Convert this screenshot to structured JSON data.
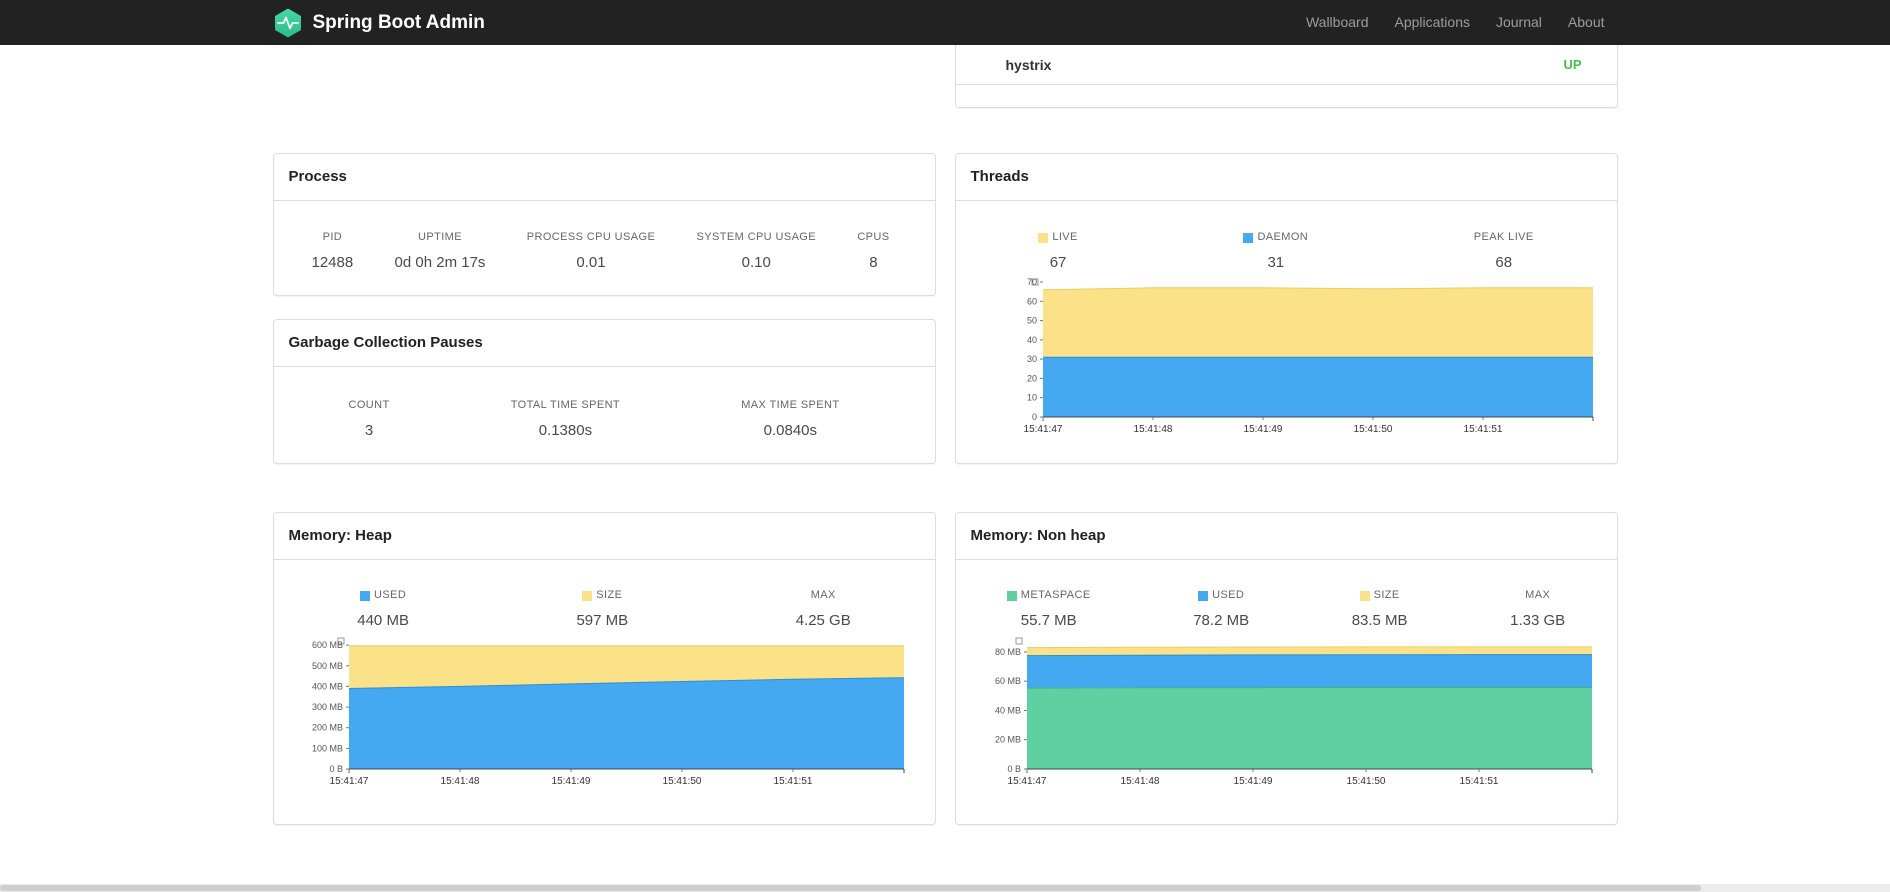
{
  "colors": {
    "accent_teal": "#36cf9b",
    "navbar_bg": "#222222",
    "status_up_green": "#42c047",
    "series_yellow": "#fbe187",
    "series_blue": "#45a9f1",
    "series_green": "#5ed0a2"
  },
  "navbar": {
    "brand": "Spring Boot Admin",
    "items": [
      {
        "label": "Wallboard"
      },
      {
        "label": "Applications"
      },
      {
        "label": "Journal"
      },
      {
        "label": "About"
      }
    ]
  },
  "applications_panel": {
    "rows": [
      {
        "name": "hystrix",
        "status": "UP"
      }
    ]
  },
  "process_panel": {
    "title": "Process",
    "metrics": [
      {
        "label": "PID",
        "value": "12488"
      },
      {
        "label": "UPTIME",
        "value": "0d 0h 2m 17s"
      },
      {
        "label": "PROCESS CPU USAGE",
        "value": "0.01"
      },
      {
        "label": "SYSTEM CPU USAGE",
        "value": "0.10"
      },
      {
        "label": "CPUS",
        "value": "8"
      }
    ]
  },
  "gc_panel": {
    "title": "Garbage Collection Pauses",
    "metrics": [
      {
        "label": "COUNT",
        "value": "3"
      },
      {
        "label": "TOTAL TIME SPENT",
        "value": "0.1380s"
      },
      {
        "label": "MAX TIME SPENT",
        "value": "0.0840s"
      }
    ]
  },
  "threads_panel": {
    "title": "Threads",
    "legend": [
      {
        "label": "LIVE",
        "value": "67",
        "swatch": "yellow"
      },
      {
        "label": "DAEMON",
        "value": "31",
        "swatch": "blue"
      },
      {
        "label": "PEAK LIVE",
        "value": "68",
        "swatch": null
      }
    ],
    "chart_data": {
      "type": "area",
      "x_labels": [
        "15:41:47",
        "15:41:48",
        "15:41:49",
        "15:41:50",
        "15:41:51"
      ],
      "y_ticks": [
        [
          0,
          "0"
        ],
        [
          10,
          "10"
        ],
        [
          20,
          "20"
        ],
        [
          30,
          "30"
        ],
        [
          40,
          "40"
        ],
        [
          50,
          "50"
        ],
        [
          60,
          "60"
        ],
        [
          70,
          "70"
        ]
      ],
      "ymax": 70,
      "series": [
        {
          "name": "LIVE",
          "color": "#fbe187",
          "stroke": "#eccd62",
          "values": [
            66,
            67,
            67,
            66.5,
            67,
            67
          ]
        },
        {
          "name": "DAEMON",
          "color": "#45a9f1",
          "stroke": "#2b8fd9",
          "values": [
            31,
            31,
            31,
            31,
            31,
            31
          ]
        }
      ]
    }
  },
  "memory_heap_panel": {
    "title": "Memory: Heap",
    "legend": [
      {
        "label": "USED",
        "value": "440 MB",
        "swatch": "blue"
      },
      {
        "label": "SIZE",
        "value": "597 MB",
        "swatch": "yellow"
      },
      {
        "label": "MAX",
        "value": "4.25 GB",
        "swatch": null
      }
    ],
    "chart_data": {
      "type": "area",
      "x_labels": [
        "15:41:47",
        "15:41:48",
        "15:41:49",
        "15:41:50",
        "15:41:51"
      ],
      "y_ticks": [
        [
          0,
          "0 B"
        ],
        [
          100,
          "100 MB"
        ],
        [
          200,
          "200 MB"
        ],
        [
          300,
          "300 MB"
        ],
        [
          400,
          "400 MB"
        ],
        [
          500,
          "500 MB"
        ],
        [
          600,
          "600 MB"
        ]
      ],
      "ymax": 620,
      "series": [
        {
          "name": "SIZE",
          "color": "#fbe187",
          "stroke": "#eccd62",
          "values": [
            597,
            597,
            597,
            597,
            597,
            597
          ]
        },
        {
          "name": "USED",
          "color": "#45a9f1",
          "stroke": "#2b8fd9",
          "values": [
            390,
            400,
            412,
            424,
            435,
            442
          ]
        }
      ]
    }
  },
  "memory_nonheap_panel": {
    "title": "Memory: Non heap",
    "legend": [
      {
        "label": "METASPACE",
        "value": "55.7 MB",
        "swatch": "green"
      },
      {
        "label": "USED",
        "value": "78.2 MB",
        "swatch": "blue"
      },
      {
        "label": "SIZE",
        "value": "83.5 MB",
        "swatch": "yellow"
      },
      {
        "label": "MAX",
        "value": "1.33 GB",
        "swatch": null
      }
    ],
    "chart_data": {
      "type": "area",
      "x_labels": [
        "15:41:47",
        "15:41:48",
        "15:41:49",
        "15:41:50",
        "15:41:51"
      ],
      "y_ticks": [
        [
          0,
          "0 B"
        ],
        [
          20,
          "20 MB"
        ],
        [
          40,
          "40 MB"
        ],
        [
          60,
          "60 MB"
        ],
        [
          80,
          "80 MB"
        ]
      ],
      "ymax": 87.5,
      "series": [
        {
          "name": "SIZE",
          "color": "#fbe187",
          "stroke": "#eccd62",
          "values": [
            83,
            83.2,
            83.4,
            83.5,
            83.5,
            83.5
          ]
        },
        {
          "name": "USED",
          "color": "#45a9f1",
          "stroke": "#2b8fd9",
          "values": [
            77.5,
            77.8,
            78,
            78.1,
            78.2,
            78.2
          ]
        },
        {
          "name": "METASPACE",
          "color": "#5ed0a2",
          "stroke": "#43b488",
          "values": [
            55.3,
            55.5,
            55.6,
            55.7,
            55.7,
            55.7
          ]
        }
      ]
    }
  }
}
